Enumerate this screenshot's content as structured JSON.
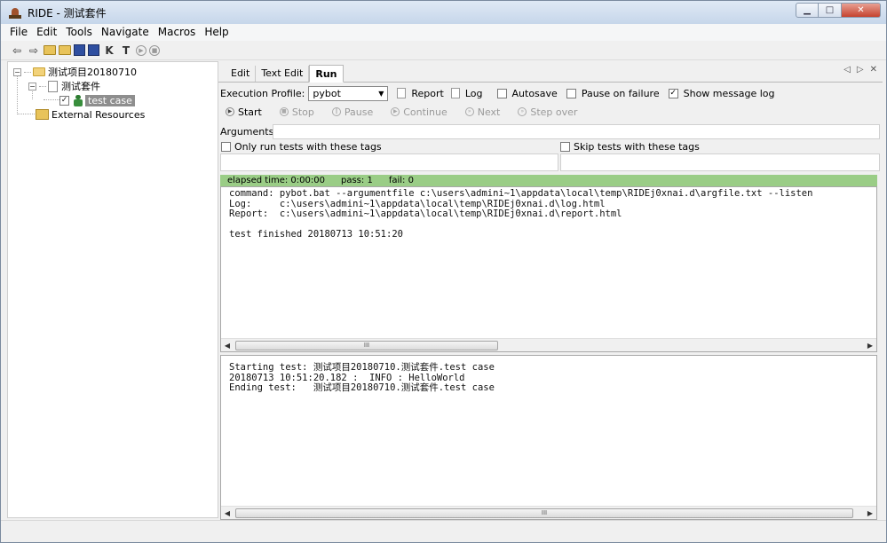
{
  "window": {
    "title": "RIDE - 测试套件"
  },
  "menu": [
    "File",
    "Edit",
    "Tools",
    "Navigate",
    "Macros",
    "Help"
  ],
  "toolbar": {
    "k_label": "K",
    "t_label": "T"
  },
  "tree": {
    "project": "测试项目20180710",
    "suite": "测试套件",
    "test_case": "test case",
    "external": "External Resources"
  },
  "tabs": [
    {
      "label": "Edit"
    },
    {
      "label": "Text Edit"
    },
    {
      "label": "Run"
    }
  ],
  "run": {
    "profile_label": "Execution Profile:",
    "profile_value": "pybot",
    "report_label": "Report",
    "log_label": "Log",
    "autosave_label": "Autosave",
    "pause_on_failure_label": "Pause on failure",
    "show_message_log_label": "Show message log",
    "buttons": {
      "start": "Start",
      "stop": "Stop",
      "pause": "Pause",
      "continue": "Continue",
      "next": "Next",
      "step_over": "Step over"
    },
    "arguments_label": "Arguments:",
    "only_run_tags_label": "Only run tests with these tags",
    "skip_tags_label": "Skip tests with these tags",
    "status": {
      "elapsed": "elapsed time: 0:00:00",
      "pass": "pass: 1",
      "fail": "fail: 0"
    },
    "output_top": "command: pybot.bat --argumentfile c:\\users\\admini~1\\appdata\\local\\temp\\RIDEj0xnai.d\\argfile.txt --listen\nLog:     c:\\users\\admini~1\\appdata\\local\\temp\\RIDEj0xnai.d\\log.html\nReport:  c:\\users\\admini~1\\appdata\\local\\temp\\RIDEj0xnai.d\\report.html\n\ntest finished 20180713 10:51:20",
    "output_bottom": "Starting test: 测试项目20180710.测试套件.test case\n20180713 10:51:20.182 :  INFO : HelloWorld\nEnding test:   测试项目20180710.测试套件.test case",
    "scroll_grip": "III"
  }
}
